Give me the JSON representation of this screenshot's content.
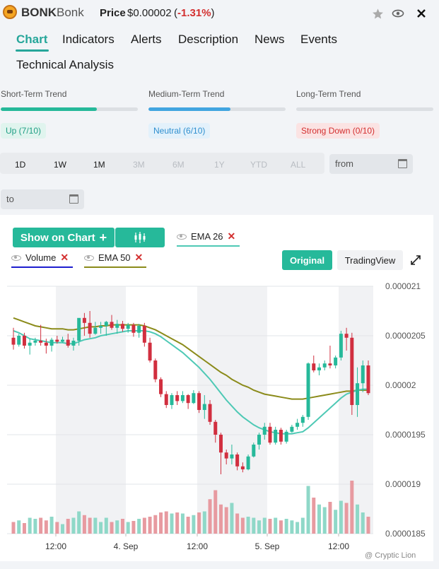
{
  "header": {
    "symbol": "BONK",
    "name": "Bonk",
    "price_label": "Price",
    "price_value": "$0.00002",
    "change_open": "(",
    "change_value": "-1.31%",
    "change_close": ")",
    "icons": [
      "star-icon",
      "eye-icon",
      "close-icon"
    ]
  },
  "tabs": [
    {
      "label": "Chart",
      "active": true
    },
    {
      "label": "Indicators"
    },
    {
      "label": "Alerts"
    },
    {
      "label": "Description"
    },
    {
      "label": "News"
    },
    {
      "label": "Events"
    },
    {
      "label": "Technical Analysis"
    }
  ],
  "trends": [
    {
      "label": "Short-Term Trend",
      "value": 7,
      "max": 10,
      "badge": "Up (7/10)",
      "color": "#26b99a",
      "badge_bg": "#e0f4ee",
      "badge_color": "#1e9e84"
    },
    {
      "label": "Medium-Term Trend",
      "value": 6,
      "max": 10,
      "badge": "Neutral (6/10)",
      "color": "#42a5e0",
      "badge_bg": "#e3f1fb",
      "badge_color": "#2f8fcf"
    },
    {
      "label": "Long-Term Trend",
      "value": 0,
      "max": 10,
      "badge": "Strong Down (0/10)",
      "color": "#d32f2f",
      "badge_bg": "#fbe3e3",
      "badge_color": "#d32f2f"
    }
  ],
  "ranges": [
    {
      "label": "1D",
      "enabled": true
    },
    {
      "label": "1W",
      "enabled": true
    },
    {
      "label": "1M",
      "enabled": true
    },
    {
      "label": "3M",
      "enabled": false
    },
    {
      "label": "6M",
      "enabled": false
    },
    {
      "label": "1Y",
      "enabled": false
    },
    {
      "label": "YTD",
      "enabled": false
    },
    {
      "label": "ALL",
      "enabled": false
    }
  ],
  "date_from": "from",
  "date_to": "to",
  "toolbar": {
    "show_on_chart": "Show on Chart",
    "plus": "+",
    "original": "Original",
    "tradingview": "TradingView"
  },
  "indicators": [
    {
      "label": "EMA 26",
      "color": "#4ec9b5"
    },
    {
      "label": "Volume",
      "color": "#1e1ecf"
    },
    {
      "label": "EMA 50",
      "color": "#8b8b1a"
    }
  ],
  "colors": {
    "accent": "#26b99a",
    "up": "#26b99a",
    "down": "#d12f3f",
    "vol_up": "#8fd8c8",
    "vol_down": "#e79aa0"
  },
  "watermark": "@ Cryptic Lion",
  "chart_data": {
    "type": "candlestick",
    "y_ticks": [
      "0.000021",
      "0.0000205",
      "0.00002",
      "0.0000195",
      "0.000019",
      "0.0000185"
    ],
    "ylim": [
      1.85e-05,
      2.1e-05
    ],
    "x_ticks": [
      "12:00",
      "4. Sep",
      "12:00",
      "5. Sep",
      "12:00"
    ],
    "candles": [
      [
        2.048e-05,
        2.058e-05,
        2.036e-05,
        2.041e-05
      ],
      [
        2.041e-05,
        2.052e-05,
        2.039e-05,
        2.05e-05
      ],
      [
        2.05e-05,
        2.053e-05,
        2.037e-05,
        2.04e-05
      ],
      [
        2.04e-05,
        2.047e-05,
        2.031e-05,
        2.043e-05
      ],
      [
        2.043e-05,
        2.048e-05,
        2.04e-05,
        2.045e-05
      ],
      [
        2.045e-05,
        2.061e-05,
        2.04e-05,
        2.043e-05
      ],
      [
        2.043e-05,
        2.047e-05,
        2.032e-05,
        2.04e-05
      ],
      [
        2.04e-05,
        2.048e-05,
        2.034e-05,
        2.046e-05
      ],
      [
        2.046e-05,
        2.05e-05,
        2.042e-05,
        2.044e-05
      ],
      [
        2.044e-05,
        2.049e-05,
        2.043e-05,
        2.046e-05
      ],
      [
        2.046e-05,
        2.052e-05,
        2.038e-05,
        2.04e-05
      ],
      [
        2.04e-05,
        2.048e-05,
        2.035e-05,
        2.045e-05
      ],
      [
        2.045e-05,
        2.066e-05,
        2.04e-05,
        2.068e-05
      ],
      [
        2.068e-05,
        2.073e-05,
        2.05e-05,
        2.063e-05
      ],
      [
        2.063e-05,
        2.075e-05,
        2.048e-05,
        2.052e-05
      ],
      [
        2.052e-05,
        2.064e-05,
        2.051e-05,
        2.058e-05
      ],
      [
        2.058e-05,
        2.064e-05,
        2.052e-05,
        2.06e-05
      ],
      [
        2.06e-05,
        2.065e-05,
        2.05e-05,
        2.064e-05
      ],
      [
        2.064e-05,
        2.071e-05,
        2.056e-05,
        2.058e-05
      ],
      [
        2.058e-05,
        2.066e-05,
        2.052e-05,
        2.062e-05
      ],
      [
        2.062e-05,
        2.065e-05,
        2.054e-05,
        2.057e-05
      ],
      [
        2.057e-05,
        2.063e-05,
        2.053e-05,
        2.061e-05
      ],
      [
        2.061e-05,
        2.063e-05,
        2.049e-05,
        2.053e-05
      ],
      [
        2.053e-05,
        2.062e-05,
        2.048e-05,
        2.06e-05
      ],
      [
        2.06e-05,
        2.063e-05,
        2.039e-05,
        2.043e-05
      ],
      [
        2.043e-05,
        2.048e-05,
        2.023e-05,
        2.025e-05
      ],
      [
        2.025e-05,
        2.027e-05,
        2.003e-05,
        2.006e-05
      ],
      [
        2.006e-05,
        2.008e-05,
        1.988e-05,
        1.991e-05
      ],
      [
        1.991e-05,
        1.994e-05,
        1.977e-05,
        1.98e-05
      ],
      [
        1.98e-05,
        1.992e-05,
        1.976e-05,
        1.99e-05
      ],
      [
        1.99e-05,
        1.994e-05,
        1.98e-05,
        1.984e-05
      ],
      [
        1.984e-05,
        1.994e-05,
        1.982e-05,
        1.99e-05
      ],
      [
        1.99e-05,
        1.991e-05,
        1.976e-05,
        1.982e-05
      ],
      [
        1.982e-05,
        1.995e-05,
        1.981e-05,
        1.992e-05
      ],
      [
        1.992e-05,
        1.994e-05,
        1.972e-05,
        1.975e-05
      ],
      [
        1.975e-05,
        1.99e-05,
        1.966e-05,
        1.981e-05
      ],
      [
        1.981e-05,
        1.985e-05,
        1.96e-05,
        1.963e-05
      ],
      [
        1.963e-05,
        1.965e-05,
        1.942e-05,
        1.95e-05
      ],
      [
        1.95e-05,
        1.952e-05,
        1.91e-05,
        1.932e-05
      ],
      [
        1.932e-05,
        1.935e-05,
        1.92e-05,
        1.926e-05
      ],
      [
        1.926e-05,
        1.94e-05,
        1.92e-05,
        1.93e-05
      ],
      [
        1.93e-05,
        1.932e-05,
        1.914e-05,
        1.918e-05
      ],
      [
        1.918e-05,
        1.922e-05,
        1.912e-05,
        1.915e-05
      ],
      [
        1.915e-05,
        1.93e-05,
        1.914e-05,
        1.928e-05
      ],
      [
        1.928e-05,
        1.942e-05,
        1.927e-05,
        1.94e-05
      ],
      [
        1.94e-05,
        1.952e-05,
        1.935e-05,
        1.95e-05
      ],
      [
        1.95e-05,
        1.962e-05,
        1.945e-05,
        1.958e-05
      ],
      [
        1.958e-05,
        1.962e-05,
        1.94e-05,
        1.942e-05
      ],
      [
        1.942e-05,
        1.958e-05,
        1.94e-05,
        1.955e-05
      ],
      [
        1.955e-05,
        1.957e-05,
        1.94e-05,
        1.943e-05
      ],
      [
        1.943e-05,
        1.955e-05,
        1.941e-05,
        1.953e-05
      ],
      [
        1.953e-05,
        1.96e-05,
        1.952e-05,
        1.958e-05
      ],
      [
        1.958e-05,
        1.966e-05,
        1.955e-05,
        1.962e-05
      ],
      [
        1.962e-05,
        1.97e-05,
        1.958e-05,
        1.968e-05
      ],
      [
        1.968e-05,
        2.023e-05,
        1.965e-05,
        2.022e-05
      ],
      [
        2.022e-05,
        2.03e-05,
        2.013e-05,
        2.015e-05
      ],
      [
        2.015e-05,
        2.022e-05,
        2.01e-05,
        2.018e-05
      ],
      [
        2.018e-05,
        2.025e-05,
        2.015e-05,
        2.022e-05
      ],
      [
        2.022e-05,
        2.04e-05,
        2.017e-05,
        2.02e-05
      ],
      [
        2.02e-05,
        2.03e-05,
        2.017e-05,
        2.028e-05
      ],
      [
        2.028e-05,
        2.055e-05,
        2.025e-05,
        2.052e-05
      ],
      [
        2.052e-05,
        2.058e-05,
        2.035e-05,
        2.048e-05
      ],
      [
        2.048e-05,
        2.053e-05,
        1.97e-05,
        1.98e-05
      ],
      [
        1.98e-05,
        2.018e-05,
        1.968e-05,
        2.002e-05
      ],
      [
        2.002e-05,
        2.025e-05,
        1.993e-05,
        2.02e-05
      ],
      [
        2.02e-05,
        2.025e-05,
        1.99e-05,
        1.992e-05
      ]
    ],
    "volume_relative": [
      0.22,
      0.25,
      0.2,
      0.3,
      0.28,
      0.3,
      0.25,
      0.32,
      0.22,
      0.18,
      0.28,
      0.3,
      0.42,
      0.35,
      0.3,
      0.3,
      0.22,
      0.3,
      0.22,
      0.25,
      0.28,
      0.22,
      0.24,
      0.28,
      0.3,
      0.32,
      0.35,
      0.4,
      0.42,
      0.38,
      0.4,
      0.38,
      0.32,
      0.35,
      0.4,
      0.42,
      0.65,
      0.82,
      0.55,
      0.5,
      0.58,
      0.38,
      0.3,
      0.32,
      0.3,
      0.25,
      0.3,
      0.28,
      0.3,
      0.25,
      0.28,
      0.25,
      0.22,
      0.3,
      0.9,
      0.68,
      0.55,
      0.5,
      0.6,
      0.45,
      0.62,
      0.58,
      1.0,
      0.55,
      0.4,
      0.32
    ],
    "ema26": [
      2.055e-05,
      2.053e-05,
      2.05e-05,
      2.047e-05,
      2.046e-05,
      2.045e-05,
      2.044e-05,
      2.043e-05,
      2.043e-05,
      2.043e-05,
      2.042e-05,
      2.042e-05,
      2.044e-05,
      2.046e-05,
      2.047e-05,
      2.048e-05,
      2.05e-05,
      2.051e-05,
      2.052e-05,
      2.053e-05,
      2.054e-05,
      2.055e-05,
      2.055e-05,
      2.055e-05,
      2.055e-05,
      2.054e-05,
      2.052e-05,
      2.049e-05,
      2.045e-05,
      2.041e-05,
      2.037e-05,
      2.033e-05,
      2.028e-05,
      2.023e-05,
      2.018e-05,
      2.012e-05,
      2.006e-05,
      1.999e-05,
      1.992e-05,
      1.985e-05,
      1.979e-05,
      1.973e-05,
      1.968e-05,
      1.964e-05,
      1.96e-05,
      1.957e-05,
      1.955e-05,
      1.953e-05,
      1.952e-05,
      1.951e-05,
      1.951e-05,
      1.951e-05,
      1.952e-05,
      1.953e-05,
      1.957e-05,
      1.962e-05,
      1.967e-05,
      1.972e-05,
      1.977e-05,
      1.982e-05,
      1.987e-05,
      1.991e-05,
      1.993e-05,
      1.995e-05,
      1.996e-05,
      1.996e-05
    ],
    "ema50": [
      2.068e-05,
      2.066e-05,
      2.064e-05,
      2.062e-05,
      2.06e-05,
      2.059e-05,
      2.058e-05,
      2.057e-05,
      2.057e-05,
      2.057e-05,
      2.056e-05,
      2.056e-05,
      2.057e-05,
      2.058e-05,
      2.059e-05,
      2.059e-05,
      2.06e-05,
      2.06e-05,
      2.061e-05,
      2.061e-05,
      2.061e-05,
      2.061e-05,
      2.061e-05,
      2.061e-05,
      2.06e-05,
      2.058e-05,
      2.056e-05,
      2.053e-05,
      2.05e-05,
      2.047e-05,
      2.044e-05,
      2.041e-05,
      2.037e-05,
      2.033e-05,
      2.029e-05,
      2.025e-05,
      2.021e-05,
      2.017e-05,
      2.013e-05,
      2.01e-05,
      2.006e-05,
      2.003e-05,
      2e-05,
      1.998e-05,
      1.995e-05,
      1.993e-05,
      1.991e-05,
      1.99e-05,
      1.989e-05,
      1.988e-05,
      1.987e-05,
      1.986e-05,
      1.986e-05,
      1.986e-05,
      1.987e-05,
      1.988e-05,
      1.989e-05,
      1.99e-05,
      1.991e-05,
      1.992e-05,
      1.993e-05,
      1.994e-05,
      1.994e-05,
      1.995e-05,
      1.995e-05,
      1.995e-05
    ]
  }
}
